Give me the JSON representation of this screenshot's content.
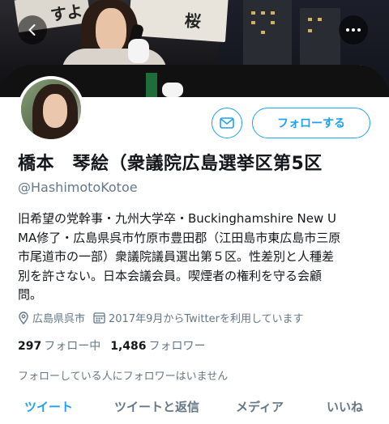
{
  "header": {
    "back_icon": "chevron-left-icon",
    "more_icon": "ellipsis-horizontal-icon",
    "banner_sign_text_1": "すよ",
    "banner_sign_text_2": "桜"
  },
  "profile": {
    "name": "橋本　琴絵（衆議院広島選挙区第5区",
    "handle": "@HashimotoKotoe",
    "bio_lines": [
      "旧希望の党幹事・九州大学卒・Buckinghamshire New U",
      "MA修了・広島県呉市竹原市豊田郡（江田島市東広島市三原",
      "市尾道市の一部）衆議院議員選出第５区。性差別と人種差",
      "別を許さない。日本会議会員。喫煙者の権利を守る会顧",
      "問。"
    ],
    "location": "広島県呉市",
    "joined": "2017年9月からTwitterを利用しています",
    "following_count": "297",
    "following_label": "フォロー中",
    "followers_count": "1,486",
    "followers_label": "フォロワー",
    "followers_you_know": "フォローしている人にフォロワーはいません"
  },
  "actions": {
    "message_icon": "envelope-icon",
    "follow_label": "フォローする"
  },
  "tabs": [
    {
      "label": "ツイート",
      "active": true
    },
    {
      "label": "ツイートと返信",
      "active": false
    },
    {
      "label": "メディア",
      "active": false
    },
    {
      "label": "いいね",
      "active": false
    }
  ],
  "colors": {
    "accent": "#1da1f2",
    "secondary_text": "#657786",
    "primary_text": "#14171a"
  }
}
